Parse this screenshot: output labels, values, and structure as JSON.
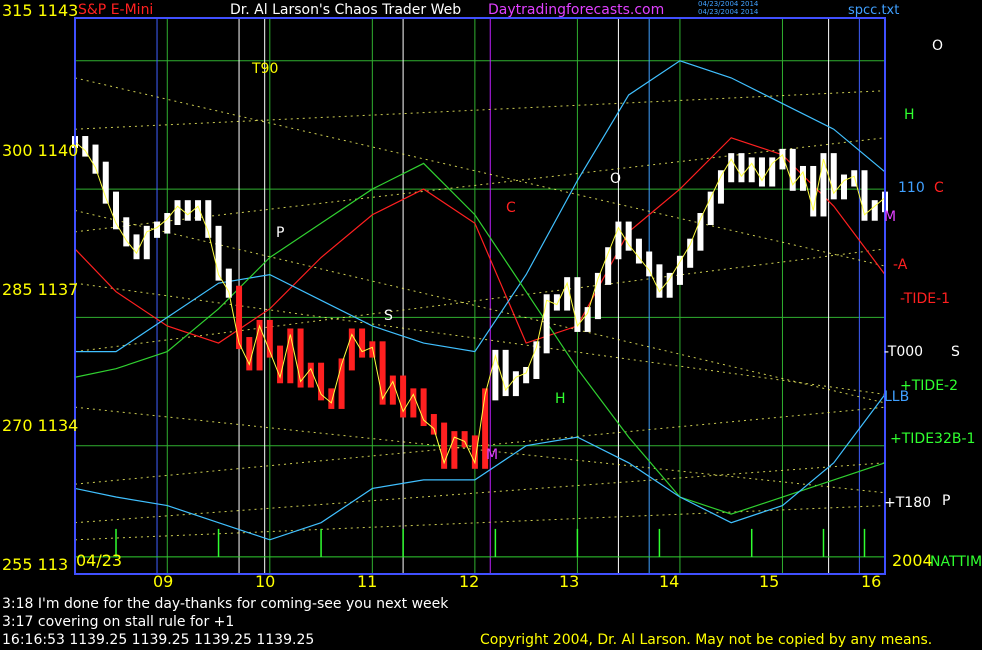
{
  "header": {
    "left_title": "S&P E-Mini",
    "center_title": "Dr. Al Larson's Chaos Trader Web",
    "site": "Daytradingforecasts.com",
    "date_line_1": "04/23/2004 2014",
    "date_line_2": "04/23/2004 2014",
    "file": "spcc.txt"
  },
  "y_labels": [
    {
      "text": "315  1143",
      "row": "r315"
    },
    {
      "text": "300  1140",
      "row": "r300"
    },
    {
      "text": "285  1137",
      "row": "r285"
    },
    {
      "text": "270  1134",
      "row": "r270"
    },
    {
      "text": "255  113",
      "row": "r255"
    }
  ],
  "start_date": "04/23",
  "end_year": "2004",
  "chart_data": {
    "type": "line",
    "title": "S&P E-Mini",
    "xlabel": "",
    "ylabel": "",
    "x_ticks": [
      "09",
      "10",
      "11",
      "12",
      "13",
      "14",
      "15",
      "16"
    ],
    "xlim": [
      8.1,
      16.0
    ],
    "ylim": [
      1131,
      1144
    ],
    "ylim_energy": [
      255,
      320
    ],
    "series": [
      {
        "name": "price",
        "x": [
          8.1,
          8.2,
          8.3,
          8.4,
          8.5,
          8.6,
          8.7,
          8.8,
          8.9,
          9.0,
          9.1,
          9.2,
          9.3,
          9.4,
          9.5,
          9.6,
          9.7,
          9.8,
          9.9,
          10.0,
          10.1,
          10.2,
          10.3,
          10.4,
          10.5,
          10.6,
          10.7,
          10.8,
          10.9,
          11.0,
          11.1,
          11.2,
          11.3,
          11.4,
          11.5,
          11.6,
          11.7,
          11.8,
          11.9,
          12.0,
          12.1,
          12.2,
          12.3,
          12.4,
          12.5,
          12.6,
          12.7,
          12.8,
          12.9,
          13.0,
          13.1,
          13.2,
          13.3,
          13.4,
          13.5,
          13.6,
          13.7,
          13.8,
          13.9,
          14.0,
          14.1,
          14.2,
          14.3,
          14.4,
          14.5,
          14.6,
          14.7,
          14.8,
          14.9,
          15.0,
          15.1,
          15.2,
          15.3,
          15.4,
          15.5,
          15.6,
          15.7,
          15.8,
          15.9,
          16.0
        ],
        "y": [
          1141.1,
          1140.9,
          1140.5,
          1139.8,
          1139.2,
          1138.8,
          1138.5,
          1139.0,
          1139.1,
          1139.3,
          1139.6,
          1139.4,
          1139.6,
          1139.0,
          1138.0,
          1137.6,
          1136.4,
          1135.9,
          1136.8,
          1136.2,
          1135.6,
          1136.6,
          1135.5,
          1135.8,
          1135.2,
          1135.0,
          1135.9,
          1136.6,
          1136.2,
          1136.3,
          1135.1,
          1135.5,
          1134.8,
          1135.2,
          1134.6,
          1134.4,
          1133.6,
          1134.2,
          1134.1,
          1133.6,
          1135.2,
          1136.1,
          1135.3,
          1135.6,
          1135.7,
          1136.3,
          1137.4,
          1137.3,
          1137.8,
          1136.8,
          1137.1,
          1137.9,
          1138.5,
          1139.1,
          1138.7,
          1138.4,
          1138.1,
          1137.6,
          1137.9,
          1138.3,
          1138.7,
          1139.3,
          1139.8,
          1140.3,
          1140.7,
          1140.3,
          1140.6,
          1140.2,
          1140.6,
          1140.8,
          1140.1,
          1140.4,
          1139.5,
          1140.7,
          1139.9,
          1140.2,
          1140.3,
          1139.4,
          1139.6,
          1139.8
        ]
      },
      {
        "name": "",
        "x": [
          8.1,
          8.5,
          9.0,
          9.5,
          10.0,
          10.5,
          11.0,
          11.5,
          12.0,
          12.5,
          13.0,
          13.5,
          14.0,
          14.5,
          15.0,
          15.5,
          16.0
        ],
        "y": [
          293,
          288,
          284,
          282,
          286,
          292,
          297,
          300,
          296,
          282,
          284,
          295,
          300,
          306,
          304,
          298,
          290
        ]
      },
      {
        "name": "",
        "x": [
          8.1,
          8.5,
          9.0,
          9.5,
          10.0,
          10.5,
          11.0,
          11.5,
          12.0,
          12.5,
          13.0,
          13.5,
          14.0,
          14.5,
          15.0,
          15.5,
          16.0
        ],
        "y": [
          281,
          281,
          285,
          289,
          290,
          287,
          284,
          282,
          281,
          290,
          301,
          311,
          315,
          313,
          310,
          307,
          302
        ]
      },
      {
        "name": "",
        "x": [
          8.1,
          8.5,
          9.0,
          9.5,
          10.0,
          10.5,
          11.0,
          11.5,
          12.0,
          12.5,
          13.0,
          13.5,
          14.0,
          14.5,
          15.0,
          15.5,
          16.0
        ],
        "y": [
          278,
          279,
          281,
          286,
          292,
          296,
          300,
          303,
          297,
          288,
          279,
          271,
          264,
          262,
          264,
          266,
          268
        ]
      },
      {
        "name": "",
        "x": [
          8.1,
          8.5,
          9.0,
          9.5,
          10.0,
          10.5,
          11.0,
          11.5,
          12.0,
          12.5,
          13.0,
          13.5,
          14.0,
          14.5,
          15.0,
          15.5,
          16.0
        ],
        "y": [
          265,
          264,
          263,
          261,
          259,
          261,
          265,
          266,
          266,
          270,
          271,
          268,
          264,
          261,
          263,
          268,
          276
        ]
      }
    ],
    "energy": {
      "baseline": 257,
      "spikes_x": [
        8.1,
        8.5,
        9.5,
        10.5,
        11.3,
        12.2,
        13.0,
        13.8,
        14.7,
        15.4,
        15.8
      ]
    }
  },
  "right_labels": [
    {
      "text": "O",
      "color": "#ffffff"
    },
    {
      "text": "H",
      "color": "#30ff30"
    },
    {
      "text": "110",
      "color": "#40a0ff"
    },
    {
      "text": "C",
      "color": "#ff2020"
    },
    {
      "text": "M",
      "color": "#e040ff"
    },
    {
      "text": "-A",
      "color": "#ff2020"
    },
    {
      "text": "-TIDE-1",
      "color": "#ff2020"
    },
    {
      "text": "-T000",
      "color": "#ffffff"
    },
    {
      "text": "S",
      "color": "#ffffff"
    },
    {
      "text": "+TIDE-2",
      "color": "#30ff30"
    },
    {
      "text": "LLB",
      "color": "#40a0ff"
    },
    {
      "text": "+TIDE32B-1",
      "color": "#30ff30"
    },
    {
      "text": "+T180",
      "color": "#ffffff"
    },
    {
      "text": "P",
      "color": "#ffffff"
    },
    {
      "text": "NATTIM",
      "color": "#30ff30"
    }
  ],
  "inchart_labels": {
    "t90": "T90",
    "p": "P",
    "s": "S",
    "c": "C",
    "o": "O",
    "h": "H",
    "m": "M"
  },
  "notes": [
    "3:18 I'm done for the day-thanks for coming-see you next week",
    "3:17 covering on stall rule for +1"
  ],
  "quote_line": "16:16:53   1139.25 1139.25 1139.25 1139.25",
  "copyright": "Copyright 2004, Dr. Al Larson. May not be copied by any means."
}
